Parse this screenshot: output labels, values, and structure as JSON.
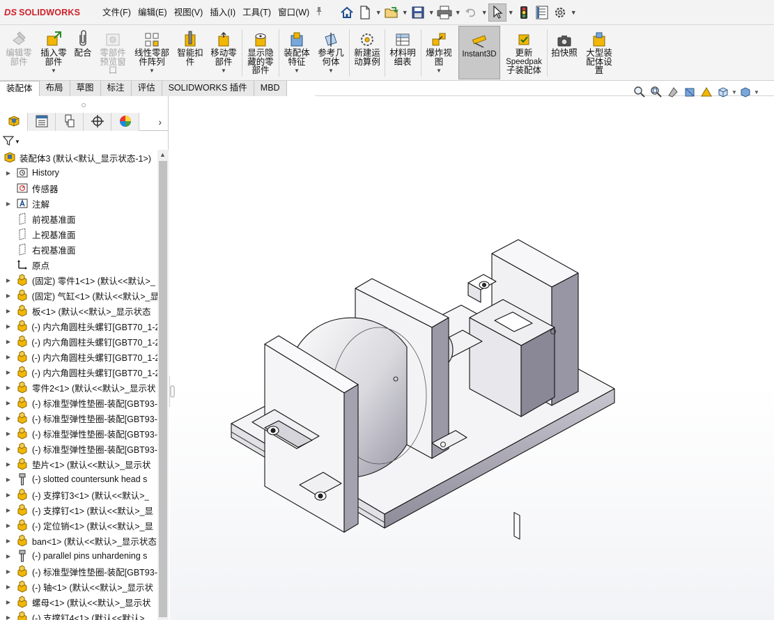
{
  "app": {
    "logo_prefix": "DS",
    "brand": "SOLIDWORKS"
  },
  "menu": [
    {
      "id": "file",
      "label": "文件(F)"
    },
    {
      "id": "edit",
      "label": "编辑(E)"
    },
    {
      "id": "view",
      "label": "视图(V)"
    },
    {
      "id": "insert",
      "label": "插入(I)"
    },
    {
      "id": "tools",
      "label": "工具(T)"
    },
    {
      "id": "window",
      "label": "窗口(W)"
    }
  ],
  "commands": [
    {
      "id": "edit-component",
      "lines": [
        "编辑零",
        "部件"
      ],
      "disabled": true
    },
    {
      "id": "insert-components",
      "lines": [
        "插入零",
        "部件"
      ],
      "caret": true
    },
    {
      "id": "mate",
      "lines": [
        "配合"
      ]
    },
    {
      "id": "component-preview",
      "lines": [
        "零部件",
        "预览窗",
        "口"
      ],
      "disabled": true
    },
    {
      "id": "linear-pattern",
      "lines": [
        "线性零部",
        "件阵列"
      ],
      "caret": true
    },
    {
      "id": "smart-fasteners",
      "lines": [
        "智能扣",
        "件"
      ]
    },
    {
      "id": "move-component",
      "lines": [
        "移动零",
        "部件"
      ],
      "caret": true
    },
    {
      "id": "show-hidden",
      "lines": [
        "显示隐",
        "藏的零",
        "部件"
      ]
    },
    {
      "id": "assembly-features",
      "lines": [
        "装配体",
        "特征"
      ],
      "caret": true
    },
    {
      "id": "reference-geometry",
      "lines": [
        "参考几",
        "何体"
      ],
      "caret": true
    },
    {
      "id": "new-motion-study",
      "lines": [
        "新建运",
        "动算例"
      ]
    },
    {
      "id": "bom",
      "lines": [
        "材料明",
        "细表"
      ]
    },
    {
      "id": "exploded-view",
      "lines": [
        "爆炸视",
        "图"
      ],
      "caret": true
    },
    {
      "id": "instant3d",
      "lines": [
        "Instant3D"
      ],
      "active": true
    },
    {
      "id": "update-speedpak",
      "lines": [
        "更新",
        "Speedpak",
        "子装配体"
      ]
    },
    {
      "id": "take-snapshot",
      "lines": [
        "拍快照"
      ]
    },
    {
      "id": "large-assembly",
      "lines": [
        "大型装",
        "配体设",
        "置"
      ]
    }
  ],
  "tabs": [
    {
      "id": "assembly",
      "label": "装配体",
      "active": true
    },
    {
      "id": "layout",
      "label": "布局"
    },
    {
      "id": "sketch",
      "label": "草图"
    },
    {
      "id": "markup",
      "label": "标注"
    },
    {
      "id": "evaluate",
      "label": "评估"
    },
    {
      "id": "addins",
      "label": "SOLIDWORKS 插件"
    },
    {
      "id": "mbd",
      "label": "MBD"
    }
  ],
  "tree": {
    "root": "装配体3  (默认<默认_显示状态-1>)",
    "items": [
      {
        "icon": "history-icon",
        "label": "History",
        "expandable": true
      },
      {
        "icon": "sensor-icon",
        "label": "传感器",
        "expandable": false
      },
      {
        "icon": "annotation-icon",
        "label": "注解",
        "expandable": true
      },
      {
        "icon": "plane-icon",
        "label": "前视基准面",
        "expandable": false
      },
      {
        "icon": "plane-icon",
        "label": "上视基准面",
        "expandable": false
      },
      {
        "icon": "plane-icon",
        "label": "右视基准面",
        "expandable": false
      },
      {
        "icon": "origin-icon",
        "label": "原点",
        "expandable": false
      },
      {
        "icon": "part-icon",
        "label": "(固定) 零件1<1> (默认<<默认>_",
        "expandable": true
      },
      {
        "icon": "part-icon",
        "label": "(固定) 气缸<1> (默认<<默认>_显",
        "expandable": true
      },
      {
        "icon": "part-icon",
        "label": "板<1> (默认<<默认>_显示状态",
        "expandable": true
      },
      {
        "icon": "part-icon",
        "label": "(-) 内六角圆柱头螺钉[GBT70_1-2",
        "expandable": true
      },
      {
        "icon": "part-icon",
        "label": "(-) 内六角圆柱头螺钉[GBT70_1-2",
        "expandable": true
      },
      {
        "icon": "part-icon",
        "label": "(-) 内六角圆柱头螺钉[GBT70_1-2",
        "expandable": true
      },
      {
        "icon": "part-icon",
        "label": "(-) 内六角圆柱头螺钉[GBT70_1-2",
        "expandable": true
      },
      {
        "icon": "part-icon",
        "label": "零件2<1> (默认<<默认>_显示状",
        "expandable": true
      },
      {
        "icon": "part-icon",
        "label": "(-) 标准型弹性垫圈-装配[GBT93-",
        "expandable": true
      },
      {
        "icon": "part-icon",
        "label": "(-) 标准型弹性垫圈-装配[GBT93-",
        "expandable": true
      },
      {
        "icon": "part-icon",
        "label": "(-) 标准型弹性垫圈-装配[GBT93-",
        "expandable": true
      },
      {
        "icon": "part-icon",
        "label": "(-) 标准型弹性垫圈-装配[GBT93-",
        "expandable": true
      },
      {
        "icon": "part-icon",
        "label": "垫片<1> (默认<<默认>_显示状",
        "expandable": true
      },
      {
        "icon": "toolbox-icon",
        "label": "(-) slotted countersunk head s",
        "expandable": true
      },
      {
        "icon": "part-icon",
        "label": "(-) 支撑钉3<1> (默认<<默认>_",
        "expandable": true
      },
      {
        "icon": "part-icon",
        "label": "(-) 支撑钉<1> (默认<<默认>_显",
        "expandable": true
      },
      {
        "icon": "part-icon",
        "label": "(-) 定位销<1> (默认<<默认>_显",
        "expandable": true
      },
      {
        "icon": "part-icon",
        "label": "ban<1> (默认<<默认>_显示状态",
        "expandable": true
      },
      {
        "icon": "toolbox-icon",
        "label": "(-) parallel pins unhardening s",
        "expandable": true
      },
      {
        "icon": "part-icon",
        "label": "(-) 标准型弹性垫圈-装配[GBT93-",
        "expandable": true
      },
      {
        "icon": "part-icon",
        "label": "(-) 轴<1> (默认<<默认>_显示状",
        "expandable": true
      },
      {
        "icon": "part-icon",
        "label": "螺母<1> (默认<<默认>_显示状",
        "expandable": true
      },
      {
        "icon": "part-icon",
        "label": "(-) 支撑钉4<1> (默认<<默认>_",
        "expandable": true
      }
    ]
  },
  "colors": {
    "accent": "#d0202a",
    "part": "#f2b705",
    "active_cmd": "#c8c8c8"
  }
}
